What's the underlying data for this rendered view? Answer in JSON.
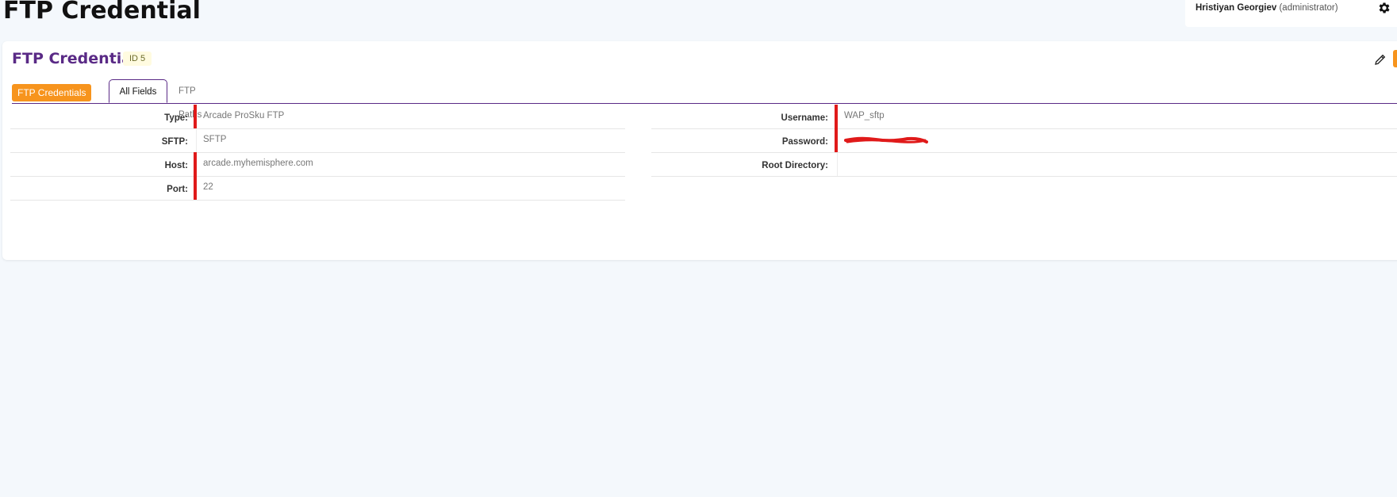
{
  "page": {
    "title": "FTP Credential"
  },
  "user": {
    "name": "Hristiyan Georgiev",
    "role": "(administrator)"
  },
  "card": {
    "title": "FTP Credential",
    "id_badge": "ID 5",
    "tabs": [
      {
        "label": "FTP Credentials",
        "style": "orange"
      },
      {
        "label": "All Fields",
        "active": true
      },
      {
        "label": "FTP Paths"
      }
    ]
  },
  "fields": {
    "left": [
      {
        "label": "Type:",
        "value": "Arcade ProSku FTP",
        "required": true
      },
      {
        "label": "SFTP:",
        "value": "SFTP",
        "required": false
      },
      {
        "label": "Host:",
        "value": "arcade.myhemisphere.com",
        "required": true
      },
      {
        "label": "Port:",
        "value": "22",
        "required": true
      }
    ],
    "right": [
      {
        "label": "Username:",
        "value": "WAP_sftp",
        "required": true
      },
      {
        "label": "Password:",
        "value": "",
        "required": true,
        "redacted": true
      },
      {
        "label": "Root Directory:",
        "value": "",
        "required": false
      }
    ]
  },
  "colors": {
    "accent": "#5a2a86",
    "orange": "#f7941d",
    "required": "#e01a1a",
    "background": "#f4f8fc"
  },
  "icons": {
    "settings": "gear-icon",
    "edit": "pencil-icon"
  }
}
